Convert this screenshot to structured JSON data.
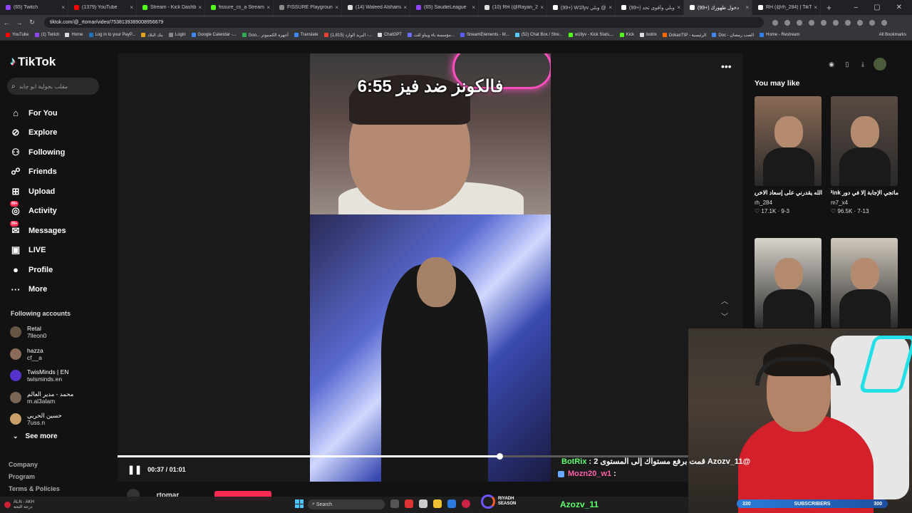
{
  "browser": {
    "tabs": [
      {
        "title": "(65) Twitch",
        "color": "#9146ff"
      },
      {
        "title": "(1379) YouTube",
        "color": "#ff0000"
      },
      {
        "title": "Stream - Kick Dashboa",
        "color": "#53fc18"
      },
      {
        "title": "fissure_cs_a Stream - ",
        "color": "#53fc18"
      },
      {
        "title": "FISSURE Playground P",
        "color": "#888888"
      },
      {
        "title": "(14) Waleed Alshamal",
        "color": "#dddddd"
      },
      {
        "title": "(65) SaudieLeague",
        "color": "#9146ff"
      },
      {
        "title": "(10) RH (@Rayan_2",
        "color": "#dddddd"
      },
      {
        "title": "(99+) W1llyv وبلي @",
        "color": "#ffffff"
      },
      {
        "title": "(99+) وبلي وأقوى تحد",
        "color": "#ffffff"
      },
      {
        "title": "(99+) دخول ظهورك",
        "color": "#ffffff",
        "active": true
      },
      {
        "title": "RH (@rh_284) | TikT",
        "color": "#ffffff"
      }
    ],
    "url": "tiktok.com/@_rtomar/video/7538139389008956679",
    "bookmarks": [
      {
        "label": "YouTube",
        "color": "#ff0000"
      },
      {
        "label": "(1) Twitch",
        "color": "#9146ff"
      },
      {
        "label": "Home",
        "color": "#dddddd"
      },
      {
        "label": "Log in to your PayP...",
        "color": "#1e73be"
      },
      {
        "label": "بنك البلاد",
        "color": "#e8a11a"
      },
      {
        "label": "Login",
        "color": "#888888"
      },
      {
        "label": "Google Calendar -...",
        "color": "#4285f4"
      },
      {
        "label": "Goo... أجهزة الكمبيوتر",
        "color": "#34a853"
      },
      {
        "label": "Translate",
        "color": "#4285f4"
      },
      {
        "label": "(1,815) البريد الوارد -...",
        "color": "#ea4335"
      },
      {
        "label": "ChatGPT",
        "color": "#dddddd"
      },
      {
        "label": "مؤسسة باء ويباو للت...",
        "color": "#6b6bff"
      },
      {
        "label": "StreamElements - M...",
        "color": "#5b5bff"
      },
      {
        "label": "(52) Chat Box / Stre...",
        "color": "#5ac8fa"
      },
      {
        "label": "w1llyv - Kick Stats,...",
        "color": "#53fc18"
      },
      {
        "label": "Kick",
        "color": "#53fc18"
      },
      {
        "label": "botrix",
        "color": "#dddddd"
      },
      {
        "label": "DokanTIP - الرئيسية",
        "color": "#ff6a00"
      },
      {
        "label": "Doc - الضب رمضان",
        "color": "#4285f4"
      },
      {
        "label": "Home - Restream",
        "color": "#2f80ed"
      }
    ],
    "all_bookmarks": "All Bookmarks"
  },
  "sidebar": {
    "logo": "TikTok",
    "search_placeholder": "مقلب بحولية ابو جابد",
    "nav": [
      {
        "label": "For You",
        "icon": "⌂"
      },
      {
        "label": "Explore",
        "icon": "⊘"
      },
      {
        "label": "Following",
        "icon": "⚇"
      },
      {
        "label": "Friends",
        "icon": "☍"
      },
      {
        "label": "Upload",
        "icon": "⊞"
      },
      {
        "label": "Activity",
        "icon": "◎",
        "badge": "99+"
      },
      {
        "label": "Messages",
        "icon": "✉",
        "badge": "99+"
      },
      {
        "label": "LIVE",
        "icon": "▣"
      },
      {
        "label": "Profile",
        "icon": "●"
      },
      {
        "label": "More",
        "icon": "···"
      }
    ],
    "following_heading": "Following accounts",
    "following": [
      {
        "name": "Retal",
        "user": "7lleon0",
        "color": "#665544"
      },
      {
        "name": "hazza",
        "user": "cf__a",
        "color": "#8a6a58"
      },
      {
        "name": "TwisMinds | EN",
        "user": "twisminds.en",
        "color": "#5533cc"
      },
      {
        "name": "محمد - مدير العالم",
        "user": "m.al3alam",
        "color": "#7a6655"
      },
      {
        "name": "حسين الحربي",
        "user": "7uss.n",
        "color": "#c9a06a"
      }
    ],
    "see_more": "See more",
    "footer": [
      "Company",
      "Program",
      "Terms & Policies"
    ]
  },
  "video": {
    "title_overlay": "فالكونز ضد فيز 6:55",
    "progress": 0.61,
    "time_current": "00:37",
    "time_total": "01:01",
    "author": "_rtomar"
  },
  "right": {
    "heading": "You may like",
    "cards": [
      {
        "caption": "الله يقدرني على إسعاد الاخرين @ALMBSHTK @Ab...",
        "user": "rh_284",
        "likes": "17.1K",
        "date": "9-3",
        "color": "#8a6a55"
      },
      {
        "caption": "ماتجي الإجابة إلا في دور Pink... خويك 😂 نكبة",
        "user": "m7_x4",
        "likes": "96.5K",
        "date": "7-13",
        "color": "#5a4a42"
      },
      {
        "caption": "",
        "user": "",
        "likes": "",
        "date": "",
        "color": "#d8d4cc"
      },
      {
        "caption": "",
        "user": "",
        "likes": "",
        "date": "",
        "color": "#cfc8bd"
      }
    ]
  },
  "stream_overlay": {
    "chat": [
      {
        "name": "BotRix",
        "text": "@Azozv_11 قمت برفع مستواك إلى المستوى 2"
      },
      {
        "name": "Mozn20_w1",
        "text": ""
      }
    ],
    "bottom_name": "Azozv_11",
    "subs_left": "330",
    "subs_label": "SUBSCRIBERS",
    "subs_right": "300"
  },
  "taskbar": {
    "left_line1": "ALN - AKH",
    "left_line2": "درجة الثجة",
    "search": "Search",
    "riyadh_line1": "RIYADH",
    "riyadh_line2": "SEASON"
  }
}
